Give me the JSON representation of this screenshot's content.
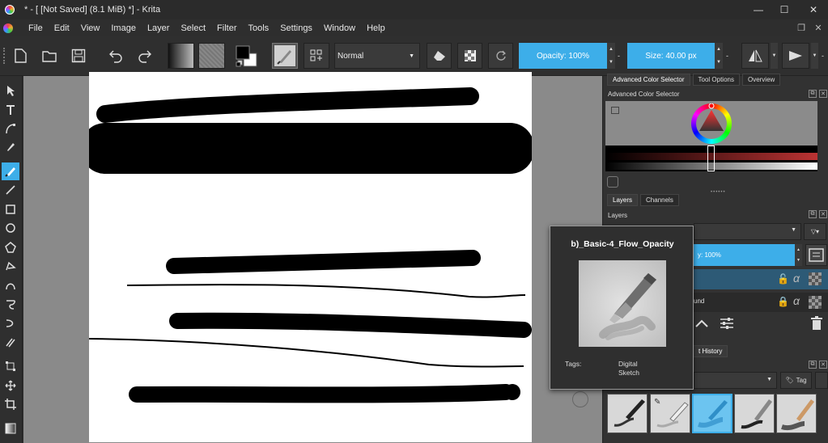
{
  "titlebar": {
    "title": "* - [ [Not Saved]  (8.1 MiB) *] - Krita",
    "minimize": "—",
    "maximize": "☐",
    "close": "✕"
  },
  "menu": [
    "File",
    "Edit",
    "View",
    "Image",
    "Layer",
    "Select",
    "Filter",
    "Tools",
    "Settings",
    "Window",
    "Help"
  ],
  "toolbar": {
    "blend_mode": "Normal",
    "opacity_label": "Opacity: 100%",
    "opacity_value": 1.0,
    "size_label": "Size: 40.00 px",
    "dash1": "-",
    "dash2": "-",
    "dash3": "-"
  },
  "dock": {
    "tabs_top": [
      "Advanced Color Selector",
      "Tool Options",
      "Overview"
    ],
    "color_selector_title": "Advanced Color Selector",
    "tabs_layers": [
      "Layers",
      "Channels"
    ],
    "layers_title": "Layers",
    "layer_opacity_label": "y: 100%",
    "background_layer_partial": "und",
    "history_tab_partial": "t History",
    "tag_button": "Tag"
  },
  "popup": {
    "preset_name": "b)_Basic-4_Flow_Opacity",
    "tags_label": "Tags:",
    "tags": [
      "Digital",
      "Sketch"
    ]
  },
  "colors": {
    "accent": "#3daee9",
    "panel": "#323232",
    "canvas": "#ffffff"
  }
}
